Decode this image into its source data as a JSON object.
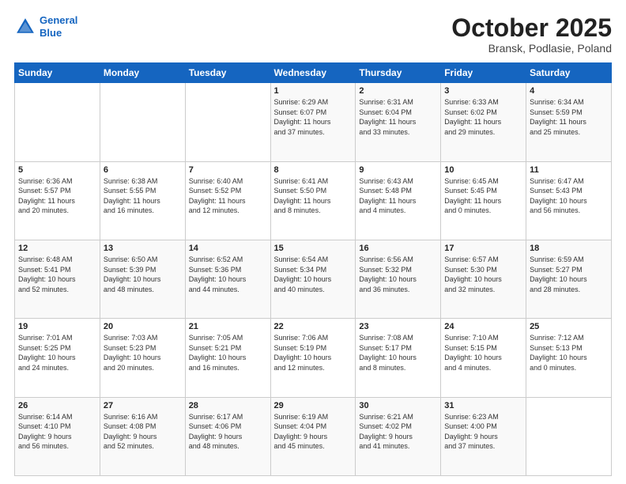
{
  "header": {
    "logo_line1": "General",
    "logo_line2": "Blue",
    "month": "October 2025",
    "location": "Bransk, Podlasie, Poland"
  },
  "weekdays": [
    "Sunday",
    "Monday",
    "Tuesday",
    "Wednesday",
    "Thursday",
    "Friday",
    "Saturday"
  ],
  "weeks": [
    [
      {
        "day": "",
        "info": ""
      },
      {
        "day": "",
        "info": ""
      },
      {
        "day": "",
        "info": ""
      },
      {
        "day": "1",
        "info": "Sunrise: 6:29 AM\nSunset: 6:07 PM\nDaylight: 11 hours\nand 37 minutes."
      },
      {
        "day": "2",
        "info": "Sunrise: 6:31 AM\nSunset: 6:04 PM\nDaylight: 11 hours\nand 33 minutes."
      },
      {
        "day": "3",
        "info": "Sunrise: 6:33 AM\nSunset: 6:02 PM\nDaylight: 11 hours\nand 29 minutes."
      },
      {
        "day": "4",
        "info": "Sunrise: 6:34 AM\nSunset: 5:59 PM\nDaylight: 11 hours\nand 25 minutes."
      }
    ],
    [
      {
        "day": "5",
        "info": "Sunrise: 6:36 AM\nSunset: 5:57 PM\nDaylight: 11 hours\nand 20 minutes."
      },
      {
        "day": "6",
        "info": "Sunrise: 6:38 AM\nSunset: 5:55 PM\nDaylight: 11 hours\nand 16 minutes."
      },
      {
        "day": "7",
        "info": "Sunrise: 6:40 AM\nSunset: 5:52 PM\nDaylight: 11 hours\nand 12 minutes."
      },
      {
        "day": "8",
        "info": "Sunrise: 6:41 AM\nSunset: 5:50 PM\nDaylight: 11 hours\nand 8 minutes."
      },
      {
        "day": "9",
        "info": "Sunrise: 6:43 AM\nSunset: 5:48 PM\nDaylight: 11 hours\nand 4 minutes."
      },
      {
        "day": "10",
        "info": "Sunrise: 6:45 AM\nSunset: 5:45 PM\nDaylight: 11 hours\nand 0 minutes."
      },
      {
        "day": "11",
        "info": "Sunrise: 6:47 AM\nSunset: 5:43 PM\nDaylight: 10 hours\nand 56 minutes."
      }
    ],
    [
      {
        "day": "12",
        "info": "Sunrise: 6:48 AM\nSunset: 5:41 PM\nDaylight: 10 hours\nand 52 minutes."
      },
      {
        "day": "13",
        "info": "Sunrise: 6:50 AM\nSunset: 5:39 PM\nDaylight: 10 hours\nand 48 minutes."
      },
      {
        "day": "14",
        "info": "Sunrise: 6:52 AM\nSunset: 5:36 PM\nDaylight: 10 hours\nand 44 minutes."
      },
      {
        "day": "15",
        "info": "Sunrise: 6:54 AM\nSunset: 5:34 PM\nDaylight: 10 hours\nand 40 minutes."
      },
      {
        "day": "16",
        "info": "Sunrise: 6:56 AM\nSunset: 5:32 PM\nDaylight: 10 hours\nand 36 minutes."
      },
      {
        "day": "17",
        "info": "Sunrise: 6:57 AM\nSunset: 5:30 PM\nDaylight: 10 hours\nand 32 minutes."
      },
      {
        "day": "18",
        "info": "Sunrise: 6:59 AM\nSunset: 5:27 PM\nDaylight: 10 hours\nand 28 minutes."
      }
    ],
    [
      {
        "day": "19",
        "info": "Sunrise: 7:01 AM\nSunset: 5:25 PM\nDaylight: 10 hours\nand 24 minutes."
      },
      {
        "day": "20",
        "info": "Sunrise: 7:03 AM\nSunset: 5:23 PM\nDaylight: 10 hours\nand 20 minutes."
      },
      {
        "day": "21",
        "info": "Sunrise: 7:05 AM\nSunset: 5:21 PM\nDaylight: 10 hours\nand 16 minutes."
      },
      {
        "day": "22",
        "info": "Sunrise: 7:06 AM\nSunset: 5:19 PM\nDaylight: 10 hours\nand 12 minutes."
      },
      {
        "day": "23",
        "info": "Sunrise: 7:08 AM\nSunset: 5:17 PM\nDaylight: 10 hours\nand 8 minutes."
      },
      {
        "day": "24",
        "info": "Sunrise: 7:10 AM\nSunset: 5:15 PM\nDaylight: 10 hours\nand 4 minutes."
      },
      {
        "day": "25",
        "info": "Sunrise: 7:12 AM\nSunset: 5:13 PM\nDaylight: 10 hours\nand 0 minutes."
      }
    ],
    [
      {
        "day": "26",
        "info": "Sunrise: 6:14 AM\nSunset: 4:10 PM\nDaylight: 9 hours\nand 56 minutes."
      },
      {
        "day": "27",
        "info": "Sunrise: 6:16 AM\nSunset: 4:08 PM\nDaylight: 9 hours\nand 52 minutes."
      },
      {
        "day": "28",
        "info": "Sunrise: 6:17 AM\nSunset: 4:06 PM\nDaylight: 9 hours\nand 48 minutes."
      },
      {
        "day": "29",
        "info": "Sunrise: 6:19 AM\nSunset: 4:04 PM\nDaylight: 9 hours\nand 45 minutes."
      },
      {
        "day": "30",
        "info": "Sunrise: 6:21 AM\nSunset: 4:02 PM\nDaylight: 9 hours\nand 41 minutes."
      },
      {
        "day": "31",
        "info": "Sunrise: 6:23 AM\nSunset: 4:00 PM\nDaylight: 9 hours\nand 37 minutes."
      },
      {
        "day": "",
        "info": ""
      }
    ]
  ]
}
